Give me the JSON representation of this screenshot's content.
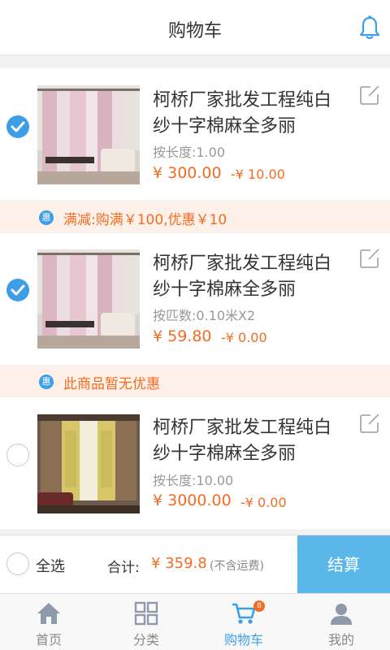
{
  "header": {
    "title": "购物车",
    "icon": "bell-icon"
  },
  "items": [
    {
      "title": "柯桥厂家批发工程纯白纱十字棉麻全多丽",
      "spec": "按长度:1.00",
      "price": "¥ 300.00",
      "discount": "-¥ 10.00",
      "checked": true
    },
    {
      "title": "柯桥厂家批发工程纯白纱十字棉麻全多丽",
      "spec": "按匹数:0.10米X2",
      "price": "¥ 59.80",
      "discount": "-¥ 0.00",
      "checked": true
    },
    {
      "title": "柯桥厂家批发工程纯白纱十字棉麻全多丽",
      "spec": "按长度:10.00",
      "price": "¥ 3000.00",
      "discount": "-¥ 0.00",
      "checked": false
    }
  ],
  "promos": [
    {
      "icon_text": "惠",
      "text": "满减:购满￥100,优惠￥10"
    },
    {
      "icon_text": "惠",
      "text": "此商品暂无优惠"
    }
  ],
  "checkout": {
    "select_all_label": "全选",
    "total_label": "合计:",
    "total_value": "¥ 359.8",
    "total_note": "(不含运费)",
    "button_label": "结算"
  },
  "tabs": [
    {
      "label": "首页",
      "icon": "home-icon"
    },
    {
      "label": "分类",
      "icon": "grid-icon"
    },
    {
      "label": "购物车",
      "icon": "cart-icon",
      "active": true,
      "badge": "8"
    },
    {
      "label": "我的",
      "icon": "user-icon"
    }
  ],
  "colors": {
    "accent": "#3d9ee8",
    "price": "#f36c21",
    "checkout": "#5bb6ea",
    "promo_bg": "#fdf1ea"
  }
}
